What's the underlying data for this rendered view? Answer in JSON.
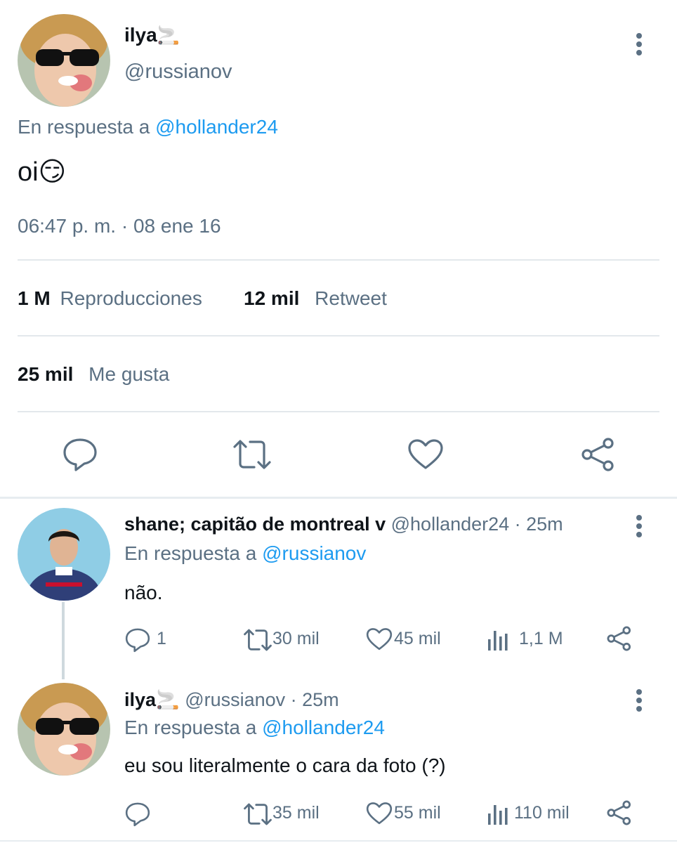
{
  "main_tweet": {
    "display_name": "ilya",
    "name_emoji": "🚬",
    "handle": "@russianov",
    "reply_prefix": "En respuesta a",
    "reply_handle": "@hollander24",
    "text": "oi",
    "text_emoji": "😏",
    "timestamp": "06:47 p. m. · 08 ene 16",
    "stats": {
      "views_count": "1 M",
      "views_label": "Reproducciones",
      "retweets_count": "12 mil",
      "retweets_label": "Retweet",
      "likes_count": "25 mil",
      "likes_label": "Me gusta"
    },
    "actions": [
      "reply-icon",
      "retweet-icon",
      "heart-icon",
      "share-icon"
    ]
  },
  "replies": [
    {
      "display_name": "shane; capitão de montreal v",
      "handle_time": "@hollander24 · 25m",
      "reply_prefix": "En respuesta a",
      "reply_handle": "@russianov",
      "text": "não.",
      "replies_count": "1",
      "retweets_count": "30 mil",
      "likes_count": "45 mil",
      "views_count": "1,1 M"
    },
    {
      "display_name": "ilya",
      "name_emoji": "🚬",
      "handle_time": "@russianov · 25m",
      "reply_prefix": "En respuesta a",
      "reply_handle": "@hollander24",
      "text": "eu sou literalmente o cara da foto (?)",
      "replies_count": "",
      "retweets_count": "35 mil",
      "likes_count": "55 mil",
      "views_count": "110 mil"
    }
  ],
  "colors": {
    "accent": "#1d9bf0",
    "secondary_text": "#5b7083",
    "divider": "#e3e8ec"
  }
}
